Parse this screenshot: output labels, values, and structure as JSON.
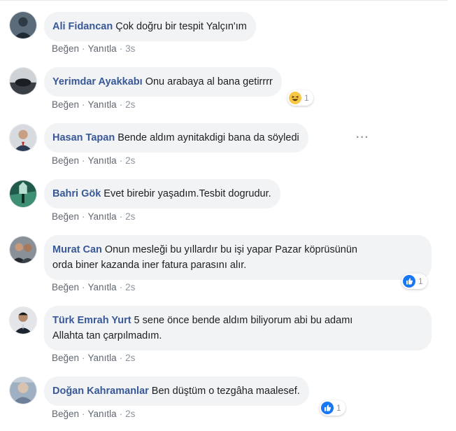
{
  "comments": [
    {
      "author": "Ali Fidancan",
      "text": "Çok doğru bir tespit Yalçın'ım",
      "like": "Beğen",
      "reply": "Yanıtla",
      "time": "3s",
      "avatar_icon": "profile-photo"
    },
    {
      "author": "Yerimdar Ayakkabı",
      "text": "Onu arabaya al bana getirrrr",
      "like": "Beğen",
      "reply": "Yanıtla",
      "time": "2s",
      "reaction": {
        "type": "haha",
        "count": "1"
      },
      "avatar_icon": "profile-photo"
    },
    {
      "author": "Hasan Tapan",
      "text": "Bende aldım aynitakdigi bana da söyledi",
      "like": "Beğen",
      "reply": "Yanıtla",
      "time": "2s",
      "more_icon": "more-options-icon",
      "avatar_icon": "profile-photo"
    },
    {
      "author": "Bahri Gök",
      "text": "Evet birebir yaşadım.Tesbit dogrudur.",
      "like": "Beğen",
      "reply": "Yanıtla",
      "time": "2s",
      "avatar_icon": "profile-photo"
    },
    {
      "author": "Murat Can",
      "text_line1": "Onun mesleği bu yıllardır bu işi yapar Pazar köprüsünün",
      "text_line2": "orda biner kazanda iner fatura parasını alır.",
      "like": "Beğen",
      "reply": "Yanıtla",
      "time": "2s",
      "reaction": {
        "type": "like",
        "count": "1"
      },
      "avatar_icon": "profile-photo"
    },
    {
      "author": "Türk Emrah Yurt",
      "text_line1": "5 sene önce bende aldım biliyorum abi bu adamı",
      "text_line2": "Allahta tan çarpılmadım.",
      "like": "Beğen",
      "reply": "Yanıtla",
      "time": "2s",
      "avatar_icon": "profile-photo"
    },
    {
      "author": "Doğan Kahramanlar",
      "text": "Ben düştüm o tezgâha maalesef.",
      "like": "Beğen",
      "reply": "Yanıtla",
      "time": "2s",
      "reaction": {
        "type": "like",
        "count": "1"
      },
      "avatar_icon": "profile-photo"
    }
  ],
  "separator": "·",
  "colors": {
    "bubble": "#f2f3f5",
    "author": "#385898",
    "action": "#616770",
    "meta": "#8d949e",
    "like_blue": "#1877f2",
    "haha_yellow": "#f7c845"
  }
}
